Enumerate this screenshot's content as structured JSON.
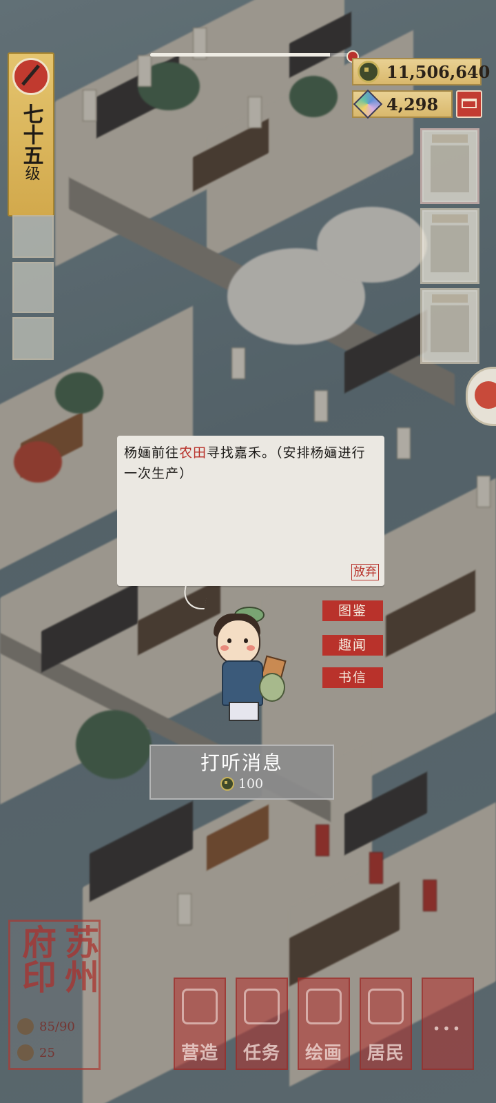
{
  "hud": {
    "level_text": "七十五级",
    "level_chars": [
      "七",
      "十",
      "五",
      "级"
    ],
    "progress": 0.9,
    "copper_coins": "11,506,640",
    "jade": "4,298"
  },
  "dialog": {
    "text_before": "杨婳前往",
    "highlight": "农田",
    "text_after": "寻找嘉禾。（安排杨婳进行一次生产）",
    "abandon_label": "放弃"
  },
  "side_tags": {
    "tag1": "图鉴",
    "tag2": "趣闻",
    "tag3": "书信"
  },
  "inquire": {
    "label": "打听消息",
    "cost": "100"
  },
  "seal": {
    "chars": [
      "苏",
      "州",
      "府",
      "印"
    ],
    "stat1": "85/90",
    "stat2": "25"
  },
  "bottom_nav": {
    "build": "营造",
    "tasks": "任务",
    "paint": "绘画",
    "residents": "居民",
    "more": "···"
  },
  "colors": {
    "accent_red": "#b9322b",
    "gold": "#d9b86c",
    "dialog_bg": "#ebe8e2"
  }
}
